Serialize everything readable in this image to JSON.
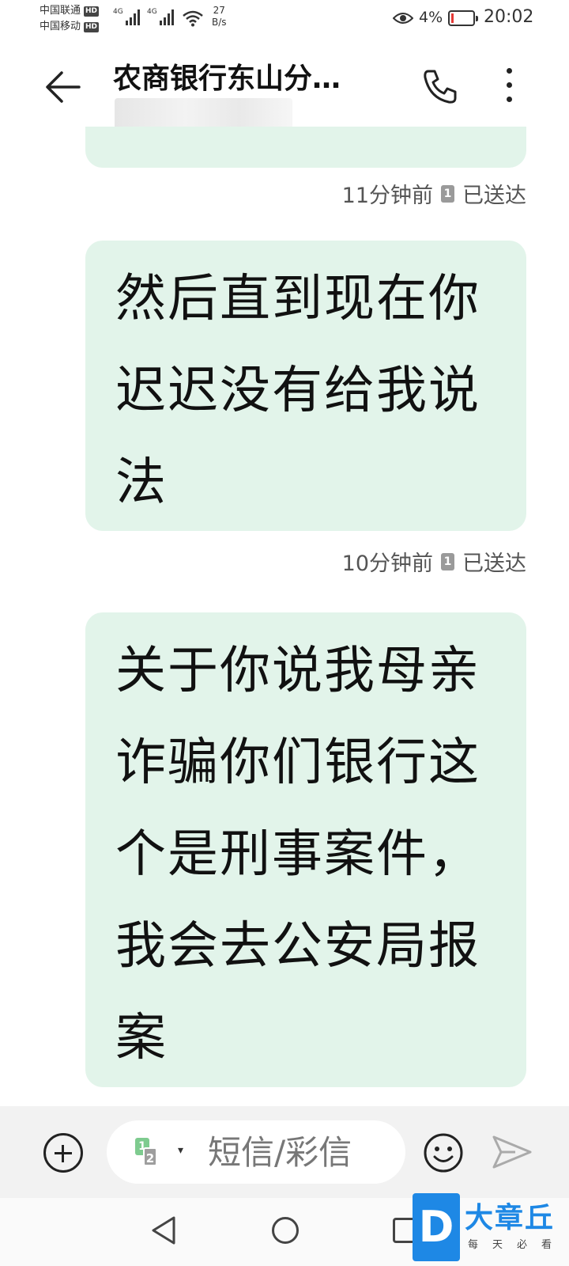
{
  "status_bar": {
    "carrier_1": "中国联通",
    "carrier_2": "中国移动",
    "hd_badge": "HD",
    "network_type": "4G",
    "net_speed_value": "27",
    "net_speed_unit": "B/s",
    "battery_percent": "4%",
    "time": "20:02"
  },
  "header": {
    "title": "农商银行东山分…",
    "back_icon": "arrow-left-icon",
    "call_icon": "phone-icon",
    "more_icon": "more-vertical-icon"
  },
  "messages": [
    {
      "text": "",
      "time": "11分钟前",
      "sim": "1",
      "status": "已送达"
    },
    {
      "text": "然后直到现在你迟迟没有给我说法",
      "time": "10分钟前",
      "sim": "1",
      "status": "已送达"
    },
    {
      "text": "关于你说我母亲诈骗你们银行这个是刑事案件，我会去公安局报案",
      "time": "",
      "sim": "",
      "status": ""
    }
  ],
  "compose": {
    "placeholder": "短信/彩信",
    "sim_primary": "1",
    "sim_secondary": "2",
    "add_icon": "plus-circle-icon",
    "emoji_icon": "smiley-icon",
    "send_icon": "send-icon"
  },
  "watermark": {
    "logo_letter": "D",
    "name": "大章丘",
    "slogan": "每天必看"
  },
  "colors": {
    "bubble": "#e2f4ea",
    "compose_bar": "#f2f2f2",
    "watermark": "#1e88e5"
  }
}
